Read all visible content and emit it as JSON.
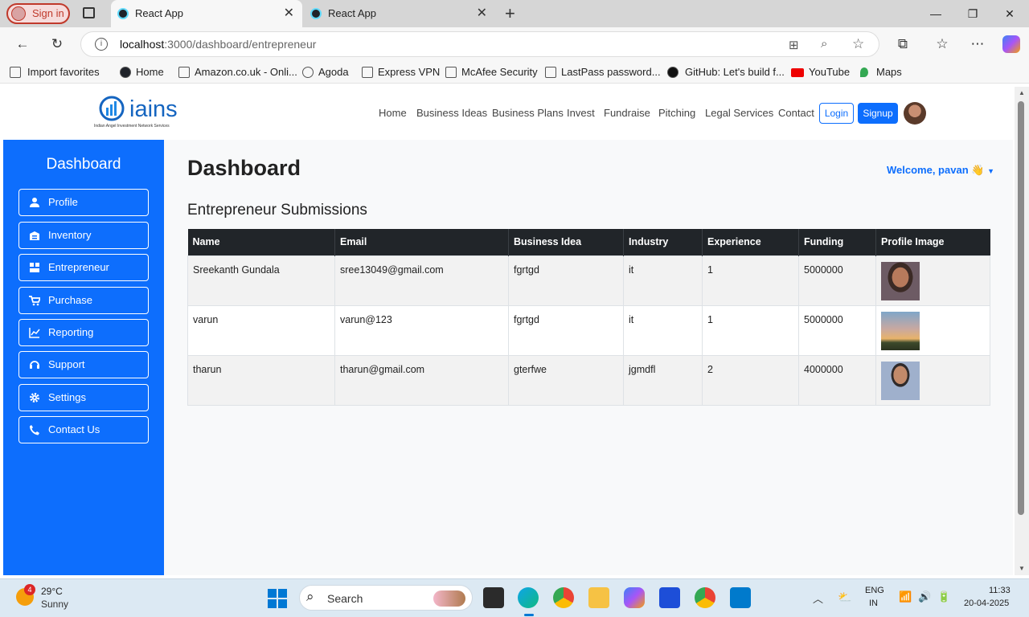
{
  "browser": {
    "signin": "Sign in",
    "tabs": [
      {
        "title": "React App",
        "active": true
      },
      {
        "title": "React App",
        "active": false
      }
    ],
    "url_host": "localhost",
    "url_path": ":3000/dashboard/entrepreneur",
    "favorites": [
      "Import favorites",
      "Home",
      "Amazon.co.uk - Onli...",
      "Agoda",
      "Express VPN",
      "McAfee Security",
      "LastPass password...",
      "GitHub: Let's build f...",
      "YouTube",
      "Maps"
    ]
  },
  "header": {
    "logo_word": "iains",
    "logo_tagline": "Indian Angel Investment Network Services",
    "menu": [
      "Home",
      "Business Ideas",
      "Business Plans",
      "Invest",
      "Fundraise",
      "Pitching",
      "Legal Services",
      "Contact"
    ],
    "login": "Login",
    "signup": "Signup"
  },
  "sidebar": {
    "title": "Dashboard",
    "items": [
      {
        "label": "Profile",
        "icon": "user-icon"
      },
      {
        "label": "Inventory",
        "icon": "inventory-icon"
      },
      {
        "label": "Entrepreneur",
        "icon": "grid-icon"
      },
      {
        "label": "Purchase",
        "icon": "cart-icon"
      },
      {
        "label": "Reporting",
        "icon": "chart-icon"
      },
      {
        "label": "Support",
        "icon": "headset-icon"
      },
      {
        "label": "Settings",
        "icon": "gear-icon"
      },
      {
        "label": "Contact Us",
        "icon": "phone-icon"
      }
    ]
  },
  "main": {
    "title": "Dashboard",
    "welcome": "Welcome, pavan 👋",
    "section_title": "Entrepreneur Submissions",
    "columns": [
      "Name",
      "Email",
      "Business Idea",
      "Industry",
      "Experience",
      "Funding",
      "Profile Image"
    ],
    "rows": [
      [
        "Sreekanth Gundala",
        "sree13049@gmail.com",
        "fgrtgd",
        "it",
        "1",
        "5000000"
      ],
      [
        "varun",
        "varun@123",
        "fgrtgd",
        "it",
        "1",
        "5000000"
      ],
      [
        "tharun",
        "tharun@gmail.com",
        "gterfwe",
        "jgmdfl",
        "2",
        "4000000"
      ]
    ]
  },
  "taskbar": {
    "weather_temp": "29°C",
    "weather_desc": "Sunny",
    "weather_badge": "4",
    "search": "Search",
    "lang": "ENG",
    "region": "IN",
    "time": "11:33",
    "date": "20-04-2025"
  },
  "colors": {
    "accent": "#0d6efd",
    "table_header": "#212529"
  }
}
